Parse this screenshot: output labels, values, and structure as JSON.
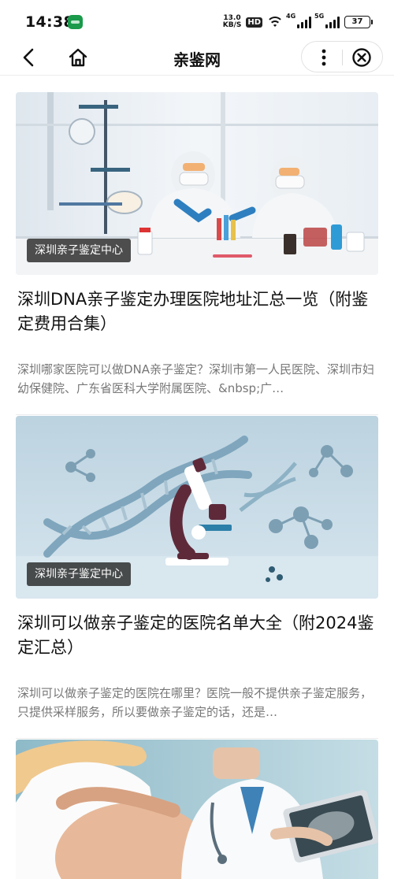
{
  "status_bar": {
    "time": "14:38",
    "net_speed_value": "13.0",
    "net_speed_unit": "KB/S",
    "hd_label": "HD",
    "sim1_label": "4G",
    "sim2_label": "5G",
    "battery_level": "37"
  },
  "nav": {
    "title": "亲鉴网",
    "back_icon": "back-arrow-icon",
    "home_icon": "home-icon",
    "more_icon": "more-vertical-icon",
    "close_icon": "close-circle-icon"
  },
  "articles": [
    {
      "source": "深圳亲子鉴定中心",
      "title": "深圳DNA亲子鉴定办理医院地址汇总一览（附鉴定费用合集）",
      "summary": "深圳哪家医院可以做DNA亲子鉴定？深圳市第一人民医院、深圳市妇幼保健院、广东省医科大学附属医院、&nbsp;广…",
      "image_desc": "lab-scientists-image"
    },
    {
      "source": "深圳亲子鉴定中心",
      "title": "深圳可以做亲子鉴定的医院名单大全（附2024鉴定汇总）",
      "summary": "深圳可以做亲子鉴定的医院在哪里？医院一般不提供亲子鉴定服务，只提供采样服务，所以要做亲子鉴定的话，还是…",
      "image_desc": "dna-microscope-image"
    },
    {
      "image_desc": "pregnant-doctor-image"
    }
  ]
}
